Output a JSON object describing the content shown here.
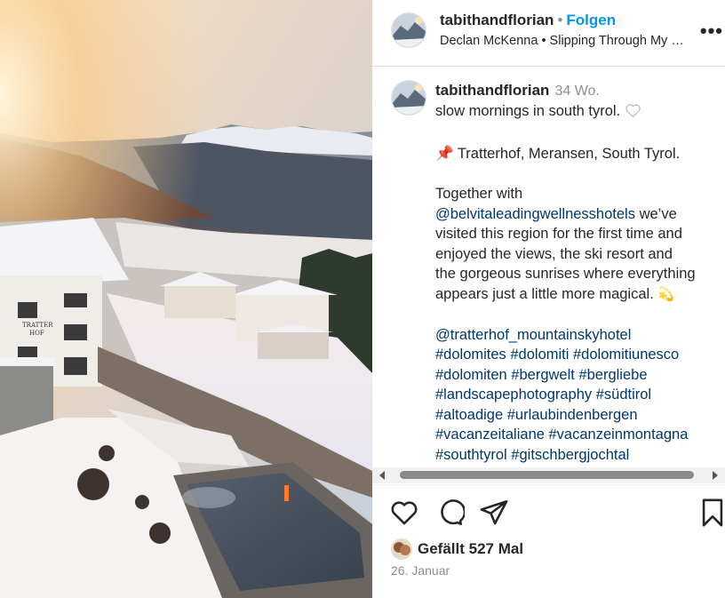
{
  "post": {
    "username": "tabithandflorian",
    "follow_label": "Folgen",
    "audio": "Declan McKenna • Slipping Through My …",
    "more_label": "•••"
  },
  "caption": {
    "username": "tabithandflorian",
    "time": "34 Wo.",
    "line_1": "slow mornings in south tyrol.",
    "location": "Tratterhof, Meransen, South Tyrol.",
    "together_1": "Together with",
    "mention_1": "@belvitaleadingwellnesshotels",
    "together_2": "we’ve",
    "together_3": "visited this region for the first time and",
    "together_4": "enjoyed the views, the ski resort and",
    "together_5": "the gorgeous sunrises where everything",
    "together_6": "appears just a little more magical.",
    "mention_2": "@tratterhof_mountainskyhotel",
    "hashtags": [
      "#dolomites #dolomiti #dolomitiunesco",
      "#dolomiten #bergwelt #bergliebe",
      "#landscapephotography #südtirol",
      "#altoadige #urlaubindenbergen",
      "#vacanzeitaliane #vacanzeinmontagna",
      "#southtyrol #gitschbergjochtal"
    ],
    "overflow_mark": "“"
  },
  "likes": {
    "text": "Gefällt 527 Mal"
  },
  "date": "26. Januar",
  "icons": {
    "like": "heart-icon",
    "comment": "comment-icon",
    "share": "share-icon",
    "save": "bookmark-icon",
    "pin": "pushpin-icon",
    "sparkle": "dizzy-icon"
  },
  "colors": {
    "follow": "#0095f6",
    "link": "#00376b",
    "muted": "#8e8e8e"
  }
}
